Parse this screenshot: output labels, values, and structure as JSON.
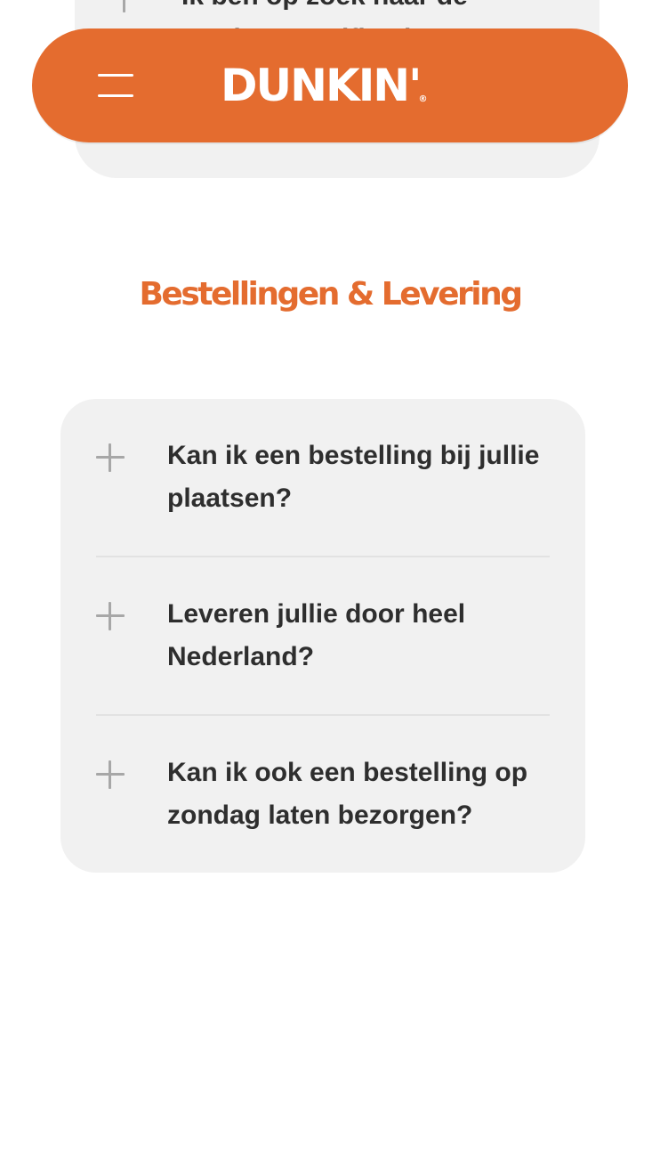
{
  "header": {
    "menu_icon": "hamburger-menu-icon",
    "logo_text": "DUNKIN'",
    "logo_registered": "®",
    "brand_color": "#e46c2f"
  },
  "previous_section": {
    "visible_question": "Ik ben op zoek naar de productspecificaties"
  },
  "section": {
    "title": "Bestellingen & Levering"
  },
  "faq": {
    "expand_icon": "plus-icon",
    "items": [
      {
        "question": "Kan ik een bestelling bij jullie plaatsen?"
      },
      {
        "question": "Leveren jullie door heel Nederland?"
      },
      {
        "question": "Kan ik ook een bestelling op zondag laten bezorgen?"
      }
    ]
  }
}
